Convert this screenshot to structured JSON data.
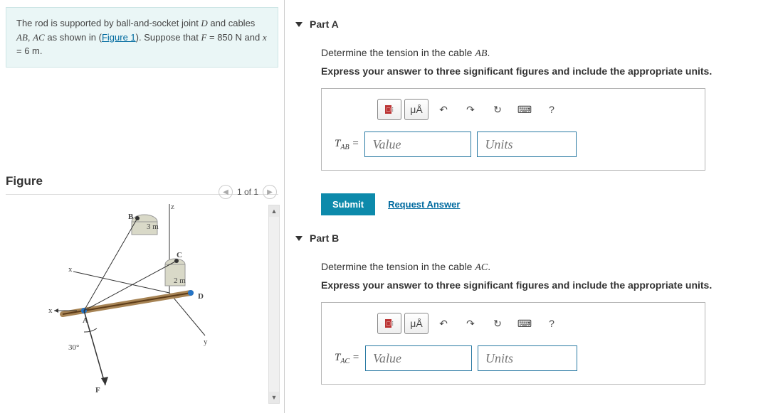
{
  "problem": {
    "text_pre": "The rod is supported by ball-and-socket joint ",
    "jointD": "D",
    "text_mid1": " and cables ",
    "cableAB": "AB",
    "sep1": ", ",
    "cableAC": "AC",
    "text_mid2": " as shown in (",
    "figure_link": "Figure 1",
    "text_mid3": "). Suppose that ",
    "Fvar": "F",
    "text_F": " = 850 N and ",
    "xvar": "x",
    "text_x": " = 6 m."
  },
  "figure": {
    "title": "Figure",
    "counter": "1 of 1",
    "labels": {
      "B": "B",
      "C": "C",
      "D": "D",
      "A": "A",
      "F": "F",
      "x": "x",
      "y": "y",
      "z": "z",
      "d1": "3 m",
      "d2": "2 m",
      "angle": "30°"
    }
  },
  "parts": [
    {
      "title": "Part A",
      "question_pre": "Determine the tension in the cable ",
      "question_var": "AB",
      "question_post": ".",
      "instruction": "Express your answer to three significant figures and include the appropriate units.",
      "label_html": "T",
      "label_sub": "AB",
      "eq": " =",
      "value_ph": "Value",
      "units_ph": "Units",
      "submit": "Submit",
      "request": "Request Answer"
    },
    {
      "title": "Part B",
      "question_pre": "Determine the tension in the cable ",
      "question_var": "AC",
      "question_post": ".",
      "instruction": "Express your answer to three significant figures and include the appropriate units.",
      "label_html": "T",
      "label_sub": "AC",
      "eq": " =",
      "value_ph": "Value",
      "units_ph": "Units",
      "submit": "Submit",
      "request": "Request Answer"
    }
  ],
  "toolbar": {
    "templates": "⁝⁚",
    "units": "μÅ",
    "undo": "↶",
    "redo": "↷",
    "reset": "↻",
    "keyboard": "⌨",
    "help": "?"
  }
}
